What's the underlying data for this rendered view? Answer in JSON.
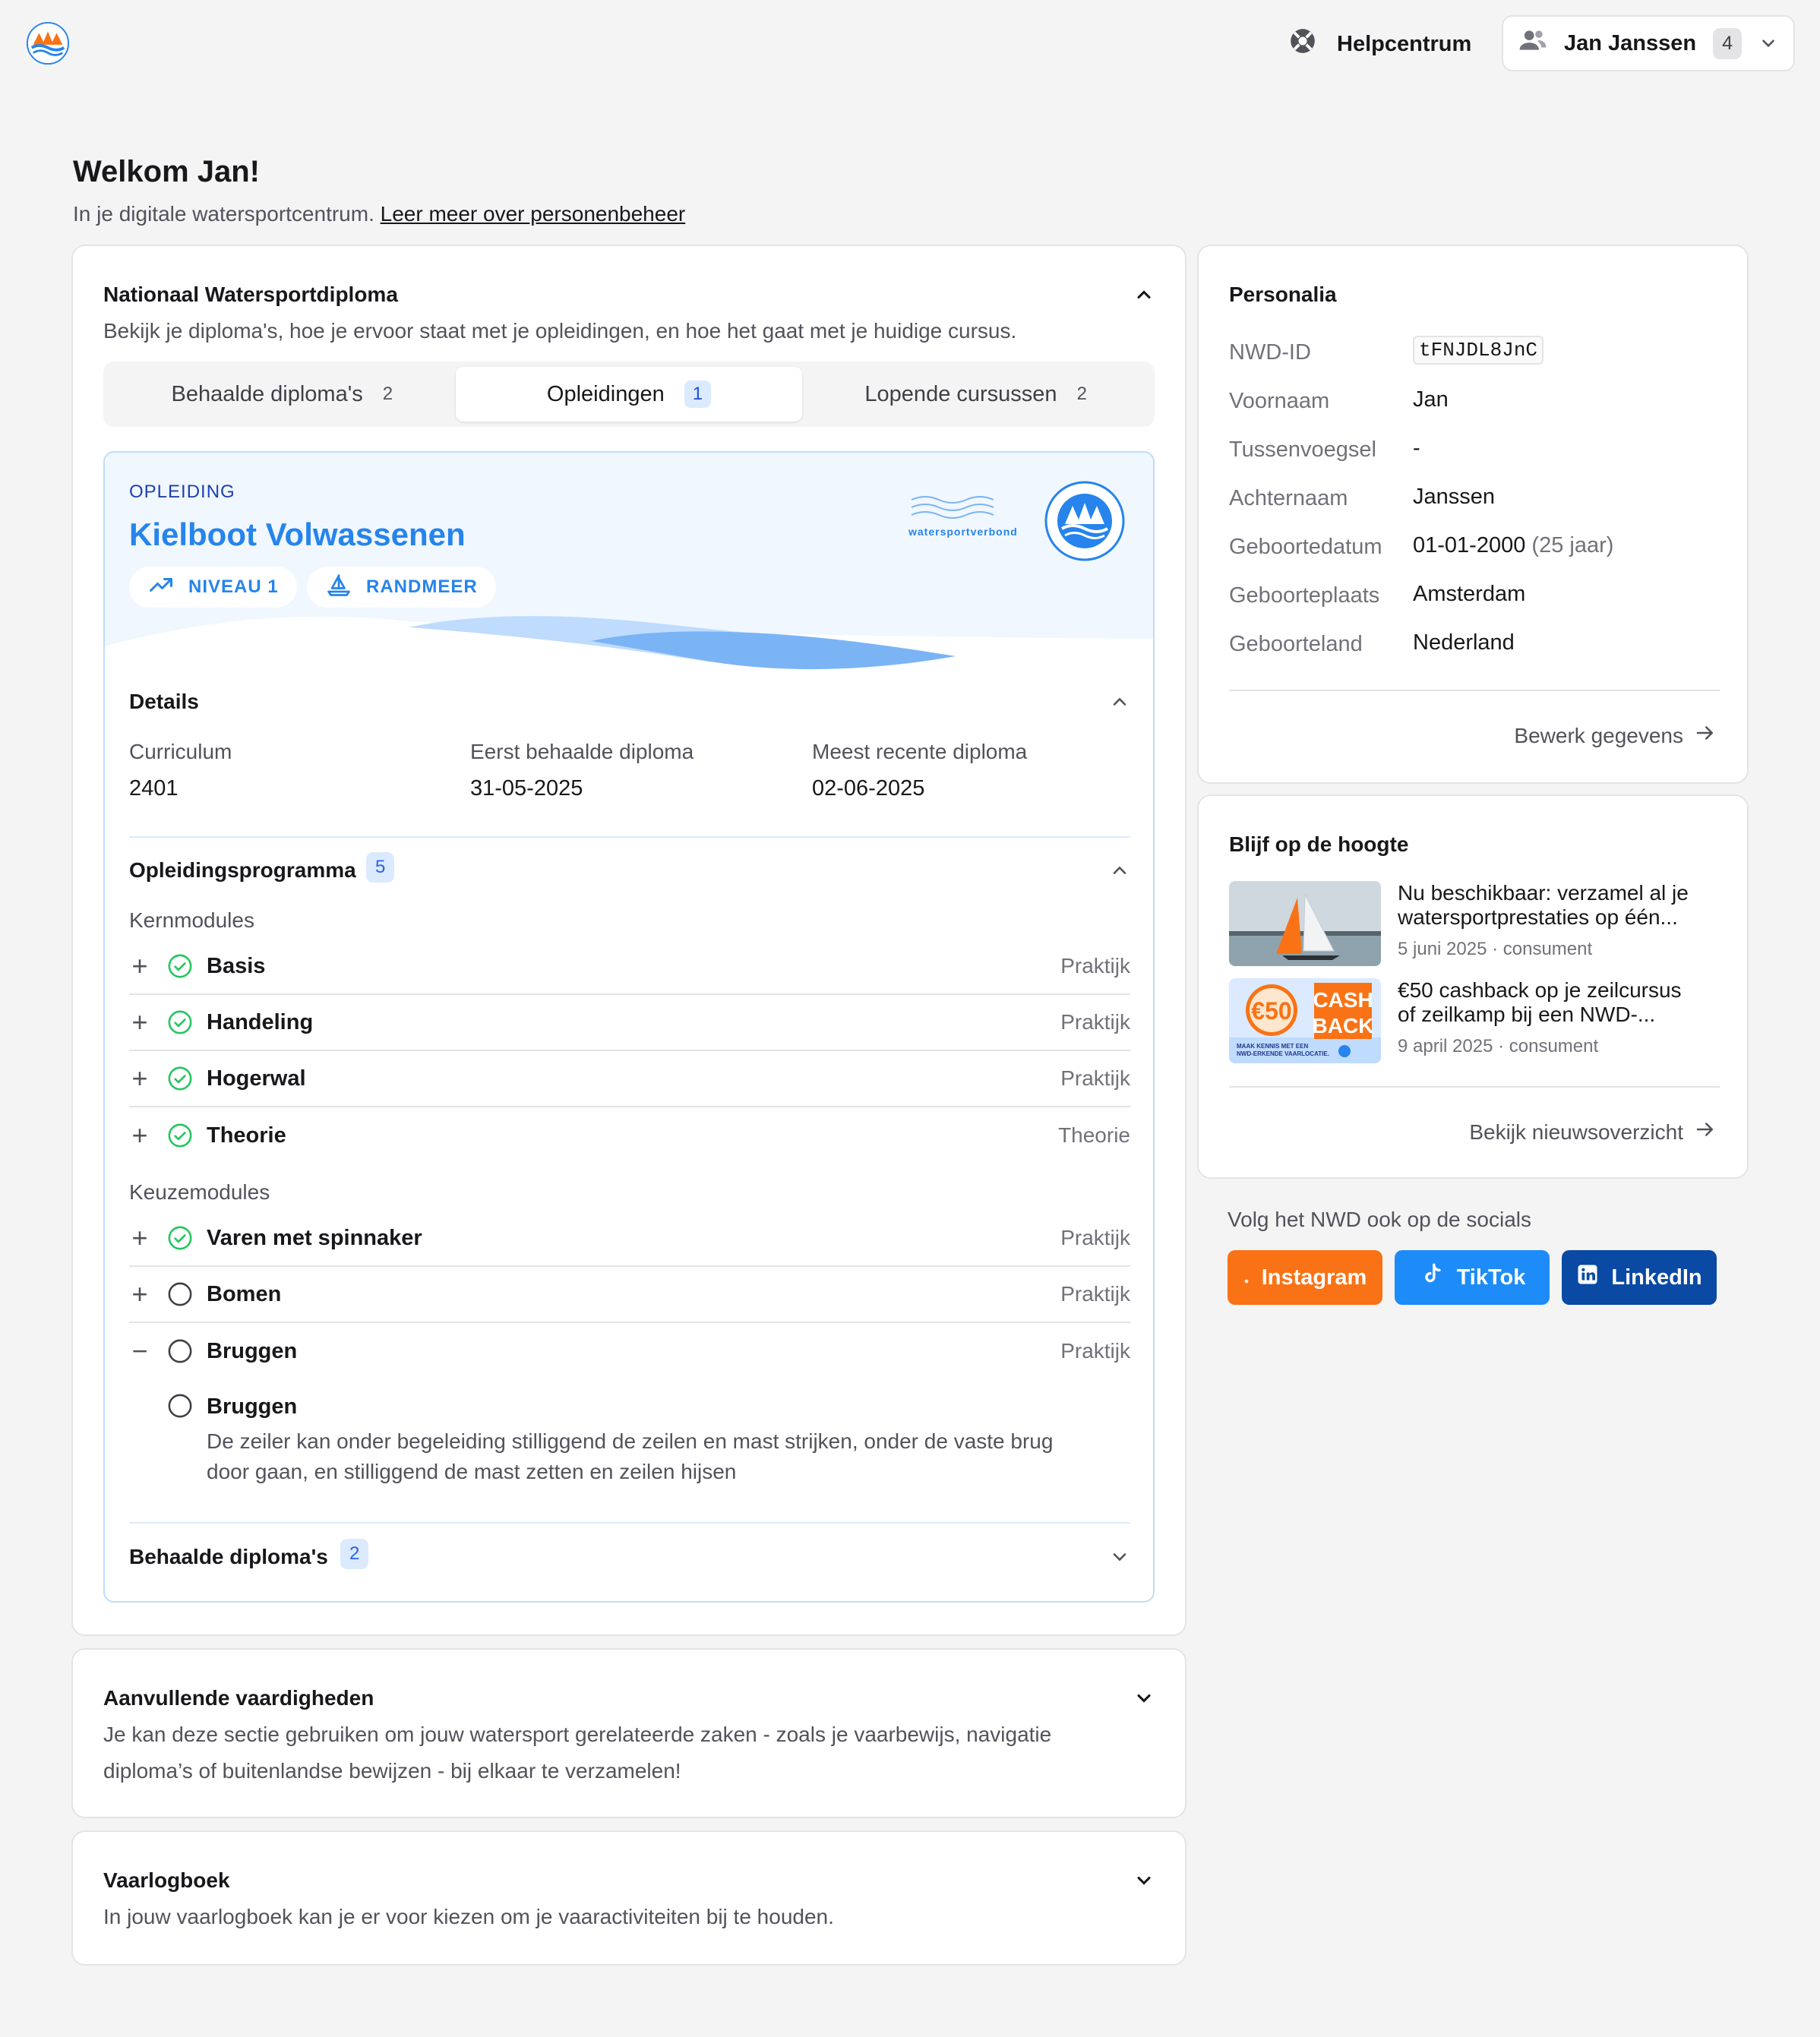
{
  "header": {
    "help_label": "Helpcentrum",
    "user_name": "Jan Janssen",
    "user_count": "4"
  },
  "welcome": {
    "title": "Welkom Jan!",
    "subtitle": "In je digitale watersportcentrum.",
    "link": "Leer meer over personenbeheer"
  },
  "nwd": {
    "title": "Nationaal Watersportdiploma",
    "desc": "Bekijk je diploma's, hoe je ervoor staat met je opleidingen, en hoe het gaat met je huidige cursus.",
    "tabs": [
      {
        "label": "Behaalde diploma's",
        "count": "2"
      },
      {
        "label": "Opleidingen",
        "count": "1"
      },
      {
        "label": "Lopende cursussen",
        "count": "2"
      }
    ],
    "program": {
      "kicker": "OPLEIDING",
      "title": "Kielboot Volwassenen",
      "pills": [
        "NIVEAU 1",
        "RANDMEER"
      ],
      "logo_text": "watersportverbond",
      "details_title": "Details",
      "details": [
        {
          "label": "Curriculum",
          "value": "2401"
        },
        {
          "label": "Eerst behaalde diploma",
          "value": "31-05-2025"
        },
        {
          "label": "Meest recente diploma",
          "value": "02-06-2025"
        }
      ],
      "programma_title": "Opleidingsprogramma",
      "programma_count": "5",
      "kern_label": "Kernmodules",
      "kern": [
        {
          "name": "Basis",
          "kind": "Praktijk",
          "done": true
        },
        {
          "name": "Handeling",
          "kind": "Praktijk",
          "done": true
        },
        {
          "name": "Hogerwal",
          "kind": "Praktijk",
          "done": true
        },
        {
          "name": "Theorie",
          "kind": "Theorie",
          "done": true
        }
      ],
      "keuze_label": "Keuzemodules",
      "keuze": [
        {
          "name": "Varen met spinnaker",
          "kind": "Praktijk",
          "done": true
        },
        {
          "name": "Bomen",
          "kind": "Praktijk",
          "done": false
        },
        {
          "name": "Bruggen",
          "kind": "Praktijk",
          "done": false
        }
      ],
      "expanded": {
        "name": "Bruggen",
        "desc1": "De zeiler kan onder begeleiding stilliggend de zeilen en mast strijken, onder de vaste brug",
        "desc2": "door gaan, en stilliggend de mast zetten en zeilen hijsen"
      },
      "behaald_title": "Behaalde diploma's",
      "behaald_count": "2"
    }
  },
  "aanvullend": {
    "title": "Aanvullende vaardigheden",
    "desc1": "Je kan deze sectie gebruiken om jouw watersport gerelateerde zaken - zoals je vaarbewijs, navigatie",
    "desc2": "diploma’s of buitenlandse bewijzen - bij elkaar te verzamelen!"
  },
  "logboek": {
    "title": "Vaarlogboek",
    "desc": "In jouw vaarlogboek kan je er voor kiezen om je vaaractiviteiten bij te houden."
  },
  "personalia": {
    "title": "Personalia",
    "nwd_id_label": "NWD-ID",
    "nwd_id": "tFNJDL8JnC",
    "fields": [
      {
        "label": "Voornaam",
        "value": "Jan"
      },
      {
        "label": "Tussenvoegsel",
        "value": "-"
      },
      {
        "label": "Achternaam",
        "value": "Janssen"
      },
      {
        "label": "Geboortedatum",
        "value": "01-01-2000",
        "extra": "(25 jaar)"
      },
      {
        "label": "Geboorteplaats",
        "value": "Amsterdam"
      },
      {
        "label": "Geboorteland",
        "value": "Nederland"
      }
    ],
    "edit_link": "Bewerk gegevens"
  },
  "news": {
    "title": "Blijf op de hoogte",
    "items": [
      {
        "title1": "Nu beschikbaar: verzamel al je",
        "title2": "watersportprestaties op één...",
        "meta": "5 juni 2025 · consument"
      },
      {
        "title1": "€50 cashback op je zeilcursus",
        "title2": "of zeilkamp bij een NWD-...",
        "meta": "9 april 2025 · consument",
        "thumb_big": "€50",
        "thumb_cash": "CASH",
        "thumb_back": "BACK",
        "thumb_small1": "MAAK KENNIS MET EEN",
        "thumb_small2": "NWD-ERKENDE VAARLOCATIE."
      }
    ],
    "overview_link": "Bekijk nieuwsoverzicht"
  },
  "socials": {
    "title": "Volg het NWD ook op de socials",
    "buttons": [
      {
        "label": "Instagram",
        "color": "#f97316"
      },
      {
        "label": "TikTok",
        "color": "#1d8cf8"
      },
      {
        "label": "LinkedIn",
        "color": "#0a4aa5"
      }
    ]
  },
  "colors": {
    "accent_blue": "#2684ec",
    "success_green": "#22c55e"
  }
}
